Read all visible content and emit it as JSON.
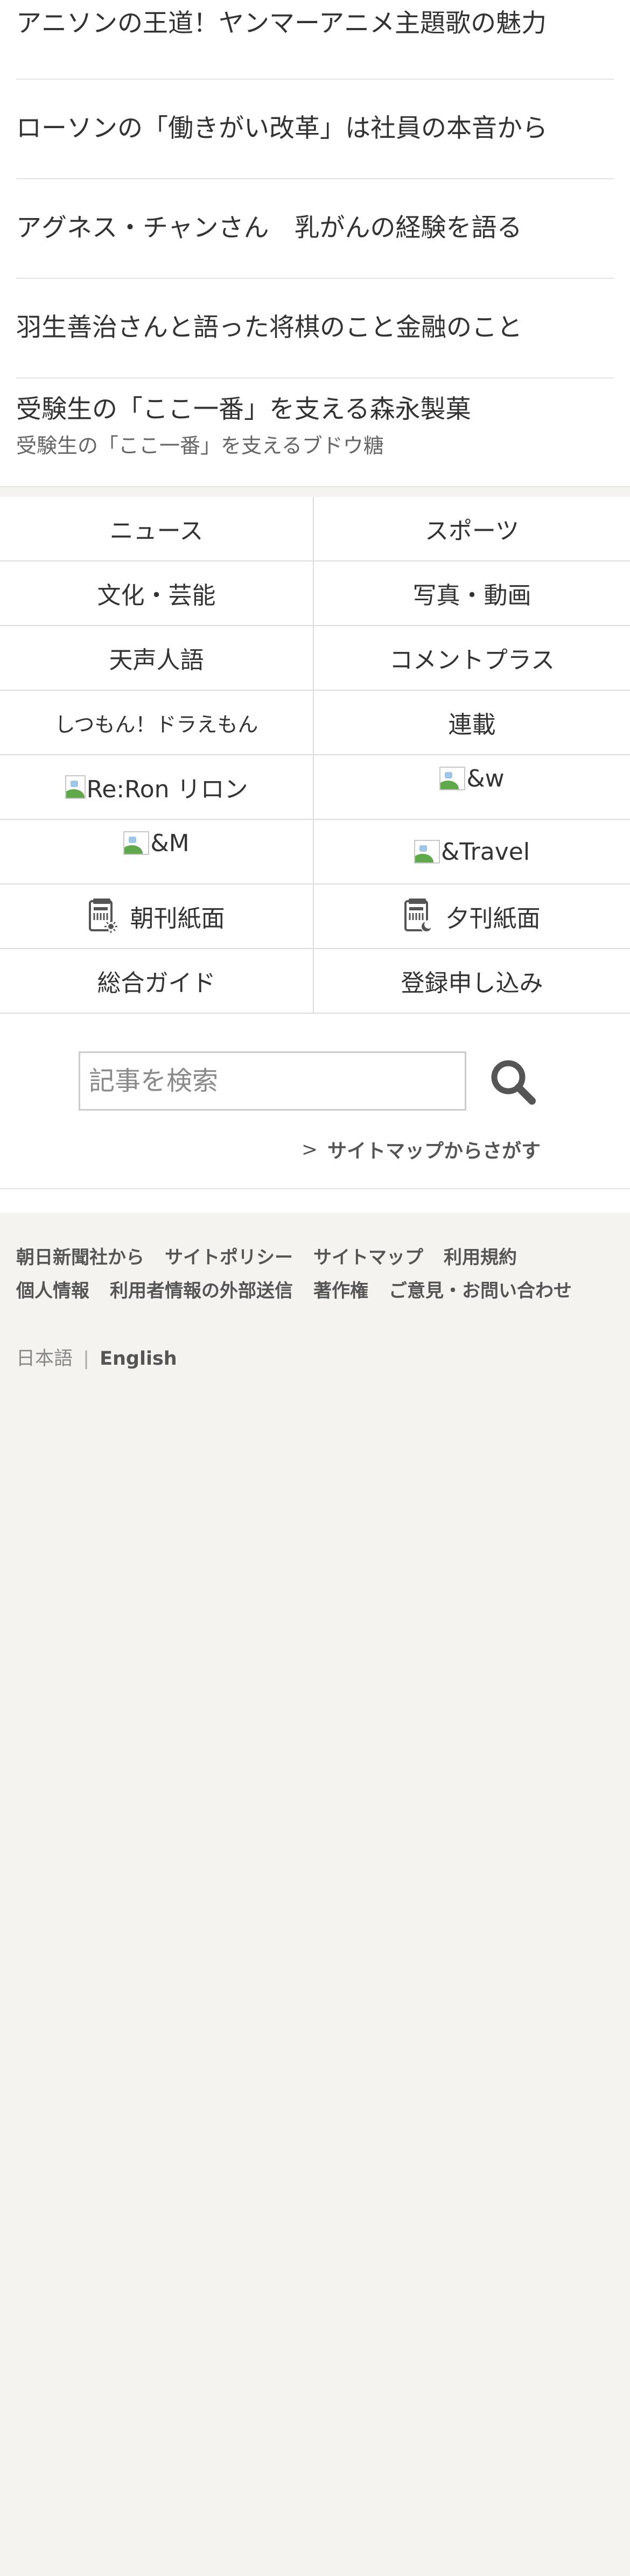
{
  "articles": [
    {
      "title": "アニソンの王道！ヤンマーアニメ主題歌の魅力"
    },
    {
      "title": "ローソンの「働きがい改革」は社員の本音から"
    },
    {
      "title": "アグネス・チャンさん　乳がんの経験を語る"
    },
    {
      "title": "羽生善治さんと語った将棋のこと金融のこと"
    },
    {
      "title": "受験生の「ここ一番」を支える森永製菓",
      "subtitle": "受験生の「ここ一番」を支えるブドウ糖"
    }
  ],
  "nav": {
    "news": "ニュース",
    "sports": "スポーツ",
    "culture": "文化・芸能",
    "photo_video": "写真・動画",
    "tenseijingo": "天声人語",
    "comment_plus": "コメントプラス",
    "doraemon": "しつもん！ドラえもん",
    "series": "連載",
    "reron": "Re:Ron リロン",
    "and_w": "&w",
    "and_m": "&M",
    "and_travel": "&Travel",
    "morning_paper": "朝刊紙面",
    "evening_paper": "夕刊紙面",
    "guide": "総合ガイド",
    "signup": "登録申し込み"
  },
  "search": {
    "placeholder": "記事を検索",
    "sitemap_link": "サイトマップからさがす"
  },
  "footer": {
    "links": [
      "朝日新聞社から",
      "サイトポリシー",
      "サイトマップ",
      "利用規約",
      "個人情報",
      "利用者情報の外部送信",
      "著作権",
      "ご意見・お問い合わせ"
    ],
    "lang_ja": "日本語",
    "lang_separator": "|",
    "lang_en": "English"
  }
}
